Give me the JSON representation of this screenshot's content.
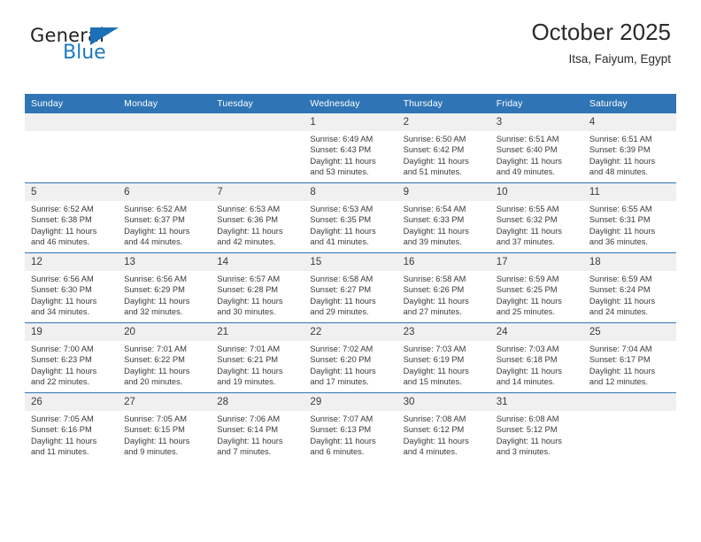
{
  "brand": {
    "name_top": "General",
    "name_bottom": "Blue",
    "triangle_color": "#1d70b8"
  },
  "header": {
    "title": "October 2025",
    "subtitle": "Itsa, Faiyum, Egypt"
  },
  "theme": {
    "header_blue": "#2f75b6",
    "daynum_bg": "#f0f0f0",
    "text": "#3a3a3a"
  },
  "weekday_headers": [
    "Sunday",
    "Monday",
    "Tuesday",
    "Wednesday",
    "Thursday",
    "Friday",
    "Saturday"
  ],
  "labels": {
    "sunrise_prefix": "Sunrise:",
    "sunset_prefix": "Sunset:",
    "daylight_prefix": "Daylight:"
  },
  "weeks": [
    [
      {
        "day": "",
        "empty": true
      },
      {
        "day": "",
        "empty": true
      },
      {
        "day": "",
        "empty": true
      },
      {
        "day": "1",
        "sunrise": "Sunrise: 6:49 AM",
        "sunset": "Sunset: 6:43 PM",
        "daylight1": "Daylight: 11 hours",
        "daylight2": "and 53 minutes."
      },
      {
        "day": "2",
        "sunrise": "Sunrise: 6:50 AM",
        "sunset": "Sunset: 6:42 PM",
        "daylight1": "Daylight: 11 hours",
        "daylight2": "and 51 minutes."
      },
      {
        "day": "3",
        "sunrise": "Sunrise: 6:51 AM",
        "sunset": "Sunset: 6:40 PM",
        "daylight1": "Daylight: 11 hours",
        "daylight2": "and 49 minutes."
      },
      {
        "day": "4",
        "sunrise": "Sunrise: 6:51 AM",
        "sunset": "Sunset: 6:39 PM",
        "daylight1": "Daylight: 11 hours",
        "daylight2": "and 48 minutes."
      }
    ],
    [
      {
        "day": "5",
        "sunrise": "Sunrise: 6:52 AM",
        "sunset": "Sunset: 6:38 PM",
        "daylight1": "Daylight: 11 hours",
        "daylight2": "and 46 minutes."
      },
      {
        "day": "6",
        "sunrise": "Sunrise: 6:52 AM",
        "sunset": "Sunset: 6:37 PM",
        "daylight1": "Daylight: 11 hours",
        "daylight2": "and 44 minutes."
      },
      {
        "day": "7",
        "sunrise": "Sunrise: 6:53 AM",
        "sunset": "Sunset: 6:36 PM",
        "daylight1": "Daylight: 11 hours",
        "daylight2": "and 42 minutes."
      },
      {
        "day": "8",
        "sunrise": "Sunrise: 6:53 AM",
        "sunset": "Sunset: 6:35 PM",
        "daylight1": "Daylight: 11 hours",
        "daylight2": "and 41 minutes."
      },
      {
        "day": "9",
        "sunrise": "Sunrise: 6:54 AM",
        "sunset": "Sunset: 6:33 PM",
        "daylight1": "Daylight: 11 hours",
        "daylight2": "and 39 minutes."
      },
      {
        "day": "10",
        "sunrise": "Sunrise: 6:55 AM",
        "sunset": "Sunset: 6:32 PM",
        "daylight1": "Daylight: 11 hours",
        "daylight2": "and 37 minutes."
      },
      {
        "day": "11",
        "sunrise": "Sunrise: 6:55 AM",
        "sunset": "Sunset: 6:31 PM",
        "daylight1": "Daylight: 11 hours",
        "daylight2": "and 36 minutes."
      }
    ],
    [
      {
        "day": "12",
        "sunrise": "Sunrise: 6:56 AM",
        "sunset": "Sunset: 6:30 PM",
        "daylight1": "Daylight: 11 hours",
        "daylight2": "and 34 minutes."
      },
      {
        "day": "13",
        "sunrise": "Sunrise: 6:56 AM",
        "sunset": "Sunset: 6:29 PM",
        "daylight1": "Daylight: 11 hours",
        "daylight2": "and 32 minutes."
      },
      {
        "day": "14",
        "sunrise": "Sunrise: 6:57 AM",
        "sunset": "Sunset: 6:28 PM",
        "daylight1": "Daylight: 11 hours",
        "daylight2": "and 30 minutes."
      },
      {
        "day": "15",
        "sunrise": "Sunrise: 6:58 AM",
        "sunset": "Sunset: 6:27 PM",
        "daylight1": "Daylight: 11 hours",
        "daylight2": "and 29 minutes."
      },
      {
        "day": "16",
        "sunrise": "Sunrise: 6:58 AM",
        "sunset": "Sunset: 6:26 PM",
        "daylight1": "Daylight: 11 hours",
        "daylight2": "and 27 minutes."
      },
      {
        "day": "17",
        "sunrise": "Sunrise: 6:59 AM",
        "sunset": "Sunset: 6:25 PM",
        "daylight1": "Daylight: 11 hours",
        "daylight2": "and 25 minutes."
      },
      {
        "day": "18",
        "sunrise": "Sunrise: 6:59 AM",
        "sunset": "Sunset: 6:24 PM",
        "daylight1": "Daylight: 11 hours",
        "daylight2": "and 24 minutes."
      }
    ],
    [
      {
        "day": "19",
        "sunrise": "Sunrise: 7:00 AM",
        "sunset": "Sunset: 6:23 PM",
        "daylight1": "Daylight: 11 hours",
        "daylight2": "and 22 minutes."
      },
      {
        "day": "20",
        "sunrise": "Sunrise: 7:01 AM",
        "sunset": "Sunset: 6:22 PM",
        "daylight1": "Daylight: 11 hours",
        "daylight2": "and 20 minutes."
      },
      {
        "day": "21",
        "sunrise": "Sunrise: 7:01 AM",
        "sunset": "Sunset: 6:21 PM",
        "daylight1": "Daylight: 11 hours",
        "daylight2": "and 19 minutes."
      },
      {
        "day": "22",
        "sunrise": "Sunrise: 7:02 AM",
        "sunset": "Sunset: 6:20 PM",
        "daylight1": "Daylight: 11 hours",
        "daylight2": "and 17 minutes."
      },
      {
        "day": "23",
        "sunrise": "Sunrise: 7:03 AM",
        "sunset": "Sunset: 6:19 PM",
        "daylight1": "Daylight: 11 hours",
        "daylight2": "and 15 minutes."
      },
      {
        "day": "24",
        "sunrise": "Sunrise: 7:03 AM",
        "sunset": "Sunset: 6:18 PM",
        "daylight1": "Daylight: 11 hours",
        "daylight2": "and 14 minutes."
      },
      {
        "day": "25",
        "sunrise": "Sunrise: 7:04 AM",
        "sunset": "Sunset: 6:17 PM",
        "daylight1": "Daylight: 11 hours",
        "daylight2": "and 12 minutes."
      }
    ],
    [
      {
        "day": "26",
        "sunrise": "Sunrise: 7:05 AM",
        "sunset": "Sunset: 6:16 PM",
        "daylight1": "Daylight: 11 hours",
        "daylight2": "and 11 minutes."
      },
      {
        "day": "27",
        "sunrise": "Sunrise: 7:05 AM",
        "sunset": "Sunset: 6:15 PM",
        "daylight1": "Daylight: 11 hours",
        "daylight2": "and 9 minutes."
      },
      {
        "day": "28",
        "sunrise": "Sunrise: 7:06 AM",
        "sunset": "Sunset: 6:14 PM",
        "daylight1": "Daylight: 11 hours",
        "daylight2": "and 7 minutes."
      },
      {
        "day": "29",
        "sunrise": "Sunrise: 7:07 AM",
        "sunset": "Sunset: 6:13 PM",
        "daylight1": "Daylight: 11 hours",
        "daylight2": "and 6 minutes."
      },
      {
        "day": "30",
        "sunrise": "Sunrise: 7:08 AM",
        "sunset": "Sunset: 6:12 PM",
        "daylight1": "Daylight: 11 hours",
        "daylight2": "and 4 minutes."
      },
      {
        "day": "31",
        "sunrise": "Sunrise: 6:08 AM",
        "sunset": "Sunset: 5:12 PM",
        "daylight1": "Daylight: 11 hours",
        "daylight2": "and 3 minutes."
      },
      {
        "day": "",
        "empty": true
      }
    ]
  ]
}
